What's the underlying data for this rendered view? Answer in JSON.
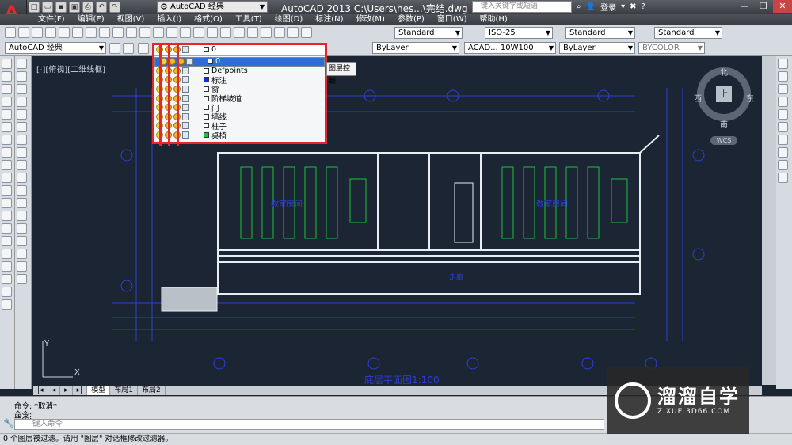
{
  "titlebar": {
    "workspace": "AutoCAD 经典",
    "app_title": "AutoCAD 2013    C:\\Users\\hes...\\完结.dwg",
    "search_placeholder": "键入关键字或短语",
    "login": "登录"
  },
  "menubar": [
    "文件(F)",
    "编辑(E)",
    "视图(V)",
    "插入(I)",
    "格式(O)",
    "工具(T)",
    "绘图(D)",
    "标注(N)",
    "修改(M)",
    "参数(P)",
    "窗口(W)",
    "帮助(H)"
  ],
  "styles": {
    "text_style": "Standard",
    "dim_style": "ISO-25",
    "table_style": "Standard",
    "multileader_style": "Standard"
  },
  "properties_bar": {
    "workspace2": "AutoCAD 经典",
    "current_layer": "0",
    "color": "ByLayer",
    "linetype": "ACAD... 10W100",
    "lineweight": "ByLayer",
    "plotstyle": "BYCOLOR"
  },
  "layer_dropdown": {
    "tooltip": "图层控制",
    "layers": [
      {
        "name": "0",
        "color": "#ffffff",
        "selected": true
      },
      {
        "name": "Defpoints",
        "color": "#ffffff",
        "selected": false
      },
      {
        "name": "标注",
        "color": "#1030e0",
        "selected": false
      },
      {
        "name": "窗",
        "color": "#ffffff",
        "selected": false
      },
      {
        "name": "阶梯坡道",
        "color": "#ffffff",
        "selected": false
      },
      {
        "name": "门",
        "color": "#ffffff",
        "selected": false
      },
      {
        "name": "墙线",
        "color": "#ffffff",
        "selected": false
      },
      {
        "name": "柱子",
        "color": "#ffffff",
        "selected": false
      },
      {
        "name": "桌椅",
        "color": "#19c43a",
        "selected": false
      }
    ]
  },
  "viewport": {
    "label": "[-][俯视][二维线框]",
    "nav_top": "上",
    "nav_north": "北",
    "nav_south": "南",
    "nav_east": "东",
    "nav_west": "西",
    "wcs": "WCS",
    "ucs_x": "X",
    "ucs_y": "Y",
    "drawing_title": "底层平面图1:100",
    "room_labels": [
      "教室房间",
      "教室房间"
    ],
    "corridor_label": "走廊"
  },
  "tabs": [
    "模型",
    "布局1",
    "布局2"
  ],
  "command": {
    "line1": "命令: *取消*",
    "line2": "命令:",
    "line3": "命令:",
    "input_placeholder": "键入命令"
  },
  "statusbar": {
    "text": "0 个图层被过滤。请用 \"图层\" 对话框修改过滤器。"
  },
  "watermark": {
    "title": "溜溜自学",
    "subtitle": "ZIXUE.3D66.COM"
  }
}
